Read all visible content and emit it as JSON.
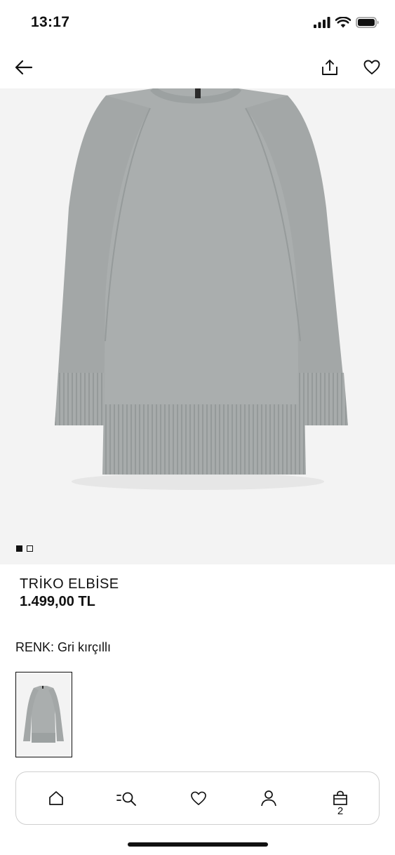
{
  "status_bar": {
    "time": "13:17"
  },
  "header": {
    "back_icon": "arrow-left-icon",
    "share_icon": "share-icon",
    "wishlist_icon": "heart-icon"
  },
  "gallery": {
    "image_count": 2,
    "active_index": 0
  },
  "product": {
    "name": "TRİKO ELBİSE",
    "price": "1.499,00 TL",
    "color_label": "RENK: Gri kırçıllı"
  },
  "bottom_nav": {
    "items": [
      {
        "name": "home",
        "icon": "home-icon"
      },
      {
        "name": "search",
        "icon": "search-menu-icon"
      },
      {
        "name": "favorites",
        "icon": "heart-icon"
      },
      {
        "name": "account",
        "icon": "user-icon"
      },
      {
        "name": "bag",
        "icon": "bag-icon",
        "count": "2"
      }
    ]
  },
  "colors": {
    "image_background": "#f3f3f3",
    "sweater_gray": "#a9adad"
  }
}
